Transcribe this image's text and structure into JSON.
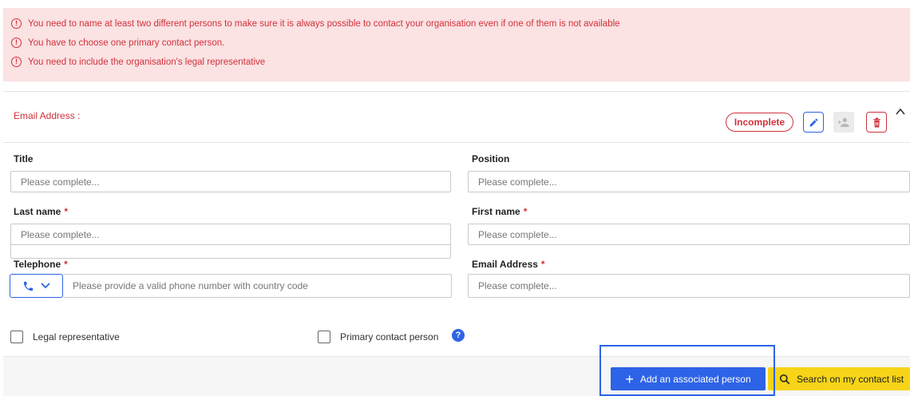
{
  "errors": [
    {
      "icon": "!",
      "text": "You need to name at least two different persons to make sure it is always possible to contact your organisation even if one of them is not available"
    },
    {
      "icon": "!",
      "text": "You have to choose one primary contact person."
    },
    {
      "icon": "!",
      "text": "You need to include the organisation's legal representative"
    }
  ],
  "contact_card": {
    "header": "Email Address :",
    "status": "Incomplete",
    "icons": {
      "edit": "pencil-icon",
      "person": "person-add-icon",
      "delete": "trash-icon",
      "collapse": "chevron-up-icon"
    }
  },
  "form": {
    "title": {
      "label": "Title",
      "placeholder": "Please complete..."
    },
    "position": {
      "label": "Position",
      "placeholder": "Please complete..."
    },
    "last_name": {
      "label": "Last name",
      "required": "*",
      "placeholder": "Please complete..."
    },
    "first_name": {
      "label": "First name",
      "required": "*",
      "placeholder": "Please complete..."
    },
    "telephone": {
      "label": "Telephone",
      "required": "*",
      "placeholder": "Please provide a valid phone number with country code"
    },
    "email": {
      "label": "Email Address",
      "required": "*",
      "placeholder": "Please complete..."
    }
  },
  "checkboxes": {
    "legal_representative": "Legal representative",
    "primary_contact": "Primary contact person",
    "help_icon": "?"
  },
  "actions": {
    "add_person": {
      "icon": "+",
      "label": "Add an associated person"
    },
    "search_contacts": {
      "label": "Search on my contact list"
    }
  },
  "colors": {
    "error": "#d0323b",
    "error_bg": "#fbe2e3",
    "primary": "#2d63e6",
    "accent_yellow": "#f7d417"
  }
}
